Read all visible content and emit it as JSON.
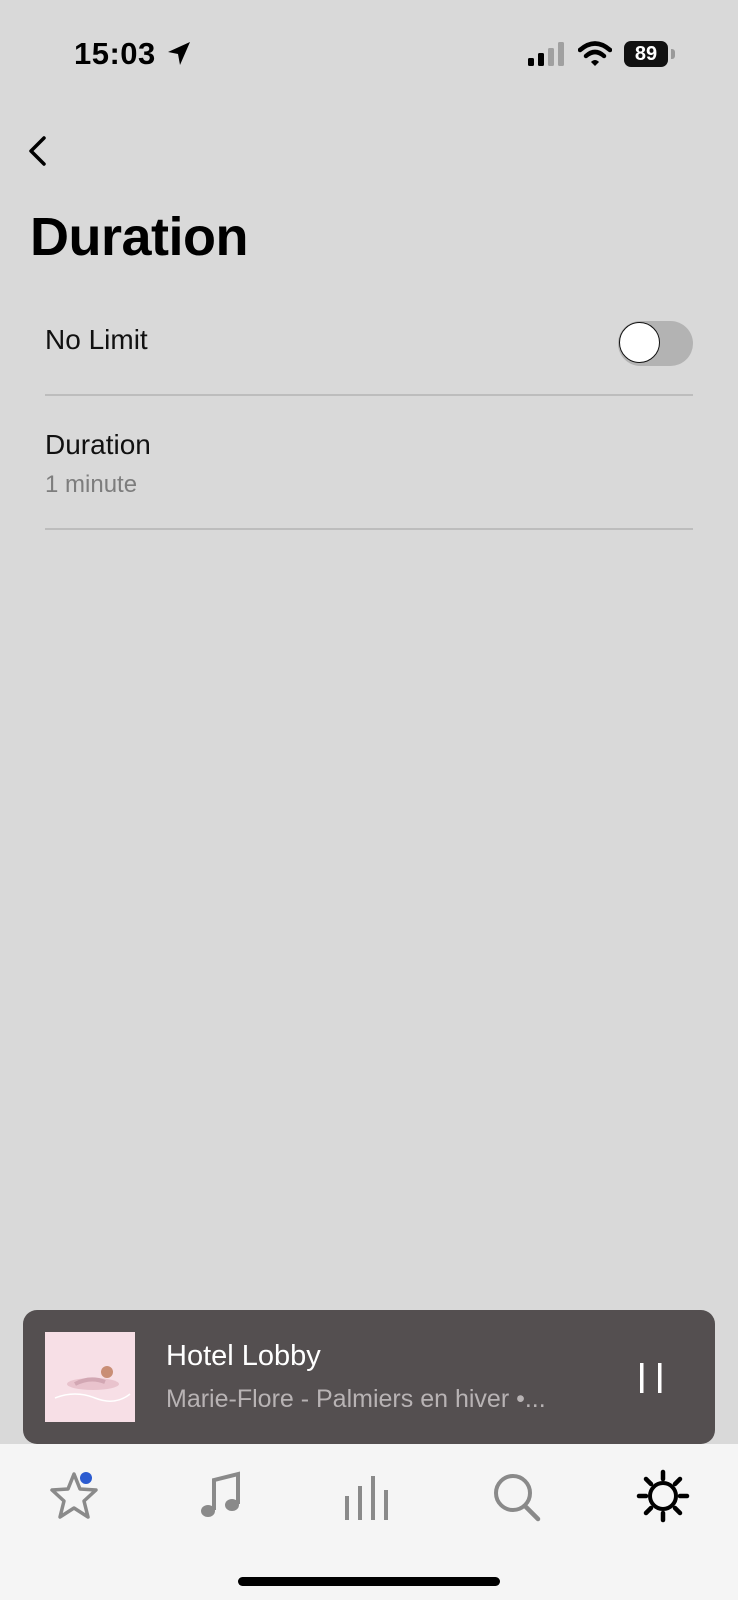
{
  "status_bar": {
    "time": "15:03",
    "battery_level": "89"
  },
  "header": {
    "title": "Duration"
  },
  "settings": {
    "no_limit": {
      "label": "No Limit",
      "enabled": false
    },
    "duration": {
      "label": "Duration",
      "value": "1 minute"
    }
  },
  "now_playing": {
    "title": "Hotel Lobby",
    "subtitle": "Marie-Flore - Palmiers en hiver •..."
  },
  "tab_bar": {
    "items": [
      {
        "icon": "star-icon",
        "has_badge": true
      },
      {
        "icon": "music-note-icon"
      },
      {
        "icon": "rooms-icon"
      },
      {
        "icon": "search-icon"
      },
      {
        "icon": "gear-icon",
        "active": true
      }
    ]
  },
  "colors": {
    "background": "#d9d9d9",
    "mini_player": "#544f50",
    "badge": "#2b5bd0"
  }
}
